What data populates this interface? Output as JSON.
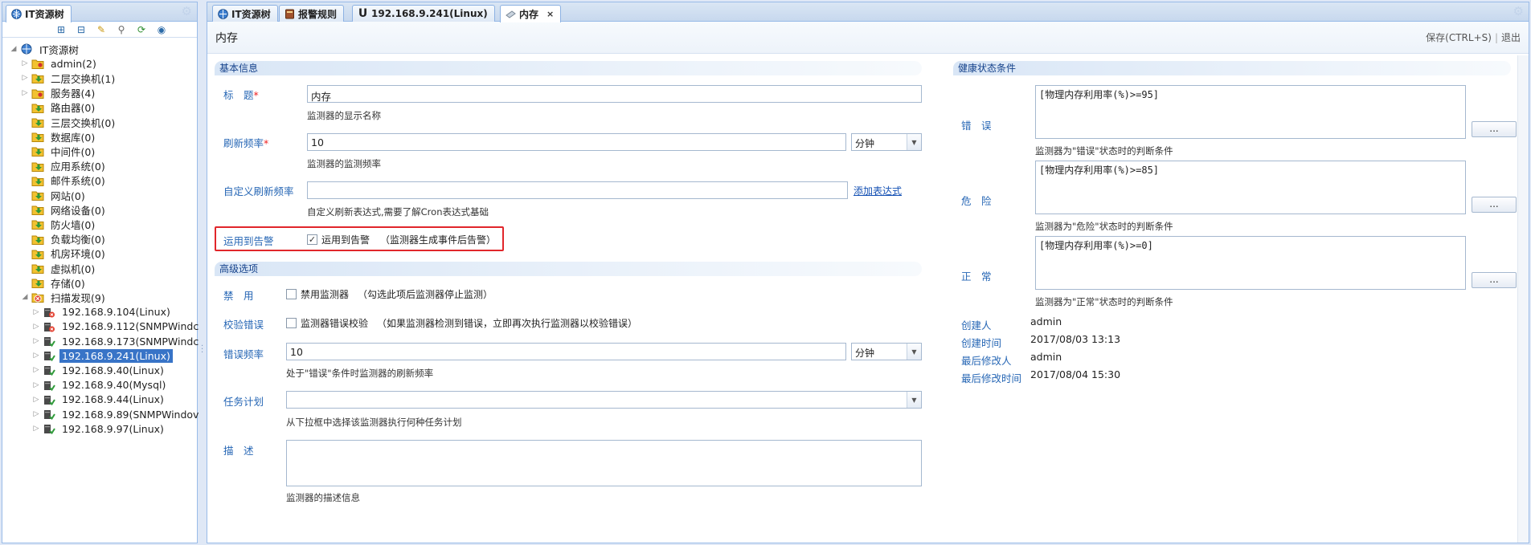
{
  "left_panel": {
    "tab_label": "IT资源树",
    "tree": [
      {
        "label": "IT资源树",
        "indent": 0,
        "toggle": "◢",
        "icon": "globe",
        "selected": false
      },
      {
        "label": "admin(2)",
        "indent": 1,
        "toggle": "▷",
        "icon": "folder-user",
        "selected": false
      },
      {
        "label": "二层交换机(1)",
        "indent": 1,
        "toggle": "▷",
        "icon": "folder-arrow",
        "selected": false
      },
      {
        "label": "服务器(4)",
        "indent": 1,
        "toggle": "▷",
        "icon": "folder-user",
        "selected": false
      },
      {
        "label": "路由器(0)",
        "indent": 1,
        "toggle": "",
        "icon": "folder-arrow",
        "selected": false
      },
      {
        "label": "三层交换机(0)",
        "indent": 1,
        "toggle": "",
        "icon": "folder-arrow",
        "selected": false
      },
      {
        "label": "数据库(0)",
        "indent": 1,
        "toggle": "",
        "icon": "folder-arrow",
        "selected": false
      },
      {
        "label": "中间件(0)",
        "indent": 1,
        "toggle": "",
        "icon": "folder-arrow",
        "selected": false
      },
      {
        "label": "应用系统(0)",
        "indent": 1,
        "toggle": "",
        "icon": "folder-arrow",
        "selected": false
      },
      {
        "label": "邮件系统(0)",
        "indent": 1,
        "toggle": "",
        "icon": "folder-arrow",
        "selected": false
      },
      {
        "label": "网站(0)",
        "indent": 1,
        "toggle": "",
        "icon": "folder-arrow",
        "selected": false
      },
      {
        "label": "网络设备(0)",
        "indent": 1,
        "toggle": "",
        "icon": "folder-arrow",
        "selected": false
      },
      {
        "label": "防火墙(0)",
        "indent": 1,
        "toggle": "",
        "icon": "folder-arrow",
        "selected": false
      },
      {
        "label": "负载均衡(0)",
        "indent": 1,
        "toggle": "",
        "icon": "folder-arrow",
        "selected": false
      },
      {
        "label": "机房环境(0)",
        "indent": 1,
        "toggle": "",
        "icon": "folder-arrow",
        "selected": false
      },
      {
        "label": "虚拟机(0)",
        "indent": 1,
        "toggle": "",
        "icon": "folder-arrow",
        "selected": false
      },
      {
        "label": "存储(0)",
        "indent": 1,
        "toggle": "",
        "icon": "folder-arrow",
        "selected": false
      },
      {
        "label": "扫描发现(9)",
        "indent": 1,
        "toggle": "◢",
        "icon": "scan-red",
        "selected": false
      },
      {
        "label": "192.168.9.104(Linux)",
        "indent": 2,
        "toggle": "▷",
        "icon": "server-error",
        "selected": false
      },
      {
        "label": "192.168.9.112(SNMPWindc",
        "indent": 2,
        "toggle": "▷",
        "icon": "server-error",
        "selected": false
      },
      {
        "label": "192.168.9.173(SNMPWindc",
        "indent": 2,
        "toggle": "▷",
        "icon": "server-ok",
        "selected": false
      },
      {
        "label": "192.168.9.241(Linux)",
        "indent": 2,
        "toggle": "▷",
        "icon": "server-ok",
        "selected": true
      },
      {
        "label": "192.168.9.40(Linux)",
        "indent": 2,
        "toggle": "▷",
        "icon": "server-ok",
        "selected": false
      },
      {
        "label": "192.168.9.40(Mysql)",
        "indent": 2,
        "toggle": "▷",
        "icon": "server-ok",
        "selected": false
      },
      {
        "label": "192.168.9.44(Linux)",
        "indent": 2,
        "toggle": "▷",
        "icon": "server-ok",
        "selected": false
      },
      {
        "label": "192.168.9.89(SNMPWindov",
        "indent": 2,
        "toggle": "▷",
        "icon": "server-ok",
        "selected": false
      },
      {
        "label": "192.168.9.97(Linux)",
        "indent": 2,
        "toggle": "▷",
        "icon": "server-ok",
        "selected": false
      }
    ]
  },
  "main_tabs": [
    {
      "label": "IT资源树",
      "icon": "globe-icon",
      "active": false
    },
    {
      "label": "报警规则",
      "icon": "book-icon",
      "active": false
    },
    {
      "label": "192.168.9.241(Linux)",
      "icon": "u-icon",
      "active": false
    },
    {
      "label": "内存",
      "icon": "memory-icon",
      "active": true,
      "close": "×"
    }
  ],
  "page": {
    "title": "内存",
    "save_label": "保存(CTRL+S)",
    "sep": "|",
    "exit_label": "退出"
  },
  "basic": {
    "section_title": "基本信息",
    "title_label": "标　题",
    "required_mark": "*",
    "title_value": "内存",
    "title_hint": "监测器的显示名称",
    "refresh_label": "刷新频率",
    "refresh_value": "10",
    "refresh_unit": "分钟",
    "refresh_hint": "监测器的监测频率",
    "custom_label": "自定义刷新频率",
    "custom_value": "",
    "custom_link": "添加表达式",
    "custom_hint": "自定义刷新表达式,需要了解Cron表达式基础",
    "alarm_label": "运用到告警",
    "alarm_checked": true,
    "alarm_check_text": "运用到告警",
    "alarm_note": "（监测器生成事件后告警）"
  },
  "advanced": {
    "section_title": "高级选项",
    "disable_label": "禁　用",
    "disable_check_text": "禁用监测器",
    "disable_note": "（勾选此项后监测器停止监测）",
    "verify_label": "校验错误",
    "verify_check_text": "监测器错误校验",
    "verify_note": "（如果监测器检测到错误，立即再次执行监测器以校验错误）",
    "errfreq_label": "错误频率",
    "errfreq_value": "10",
    "errfreq_unit": "分钟",
    "errfreq_hint": "处于\"错误\"条件时监测器的刷新频率",
    "schedule_label": "任务计划",
    "schedule_value": "",
    "schedule_hint": "从下拉框中选择该监测器执行何种任务计划",
    "desc_label": "描　述",
    "desc_value": "",
    "desc_hint": "监测器的描述信息"
  },
  "health": {
    "section_title": "健康状态条件",
    "error_label": "错　误",
    "error_value": "[物理内存利用率(%)>=95]",
    "error_hint": "监测器为\"错误\"状态时的判断条件",
    "danger_label": "危　险",
    "danger_value": "[物理内存利用率(%)>=85]",
    "danger_hint": "监测器为\"危险\"状态时的判断条件",
    "normal_label": "正　常",
    "normal_value": "[物理内存利用率(%)>=0]",
    "normal_hint": "监测器为\"正常\"状态时的判断条件",
    "dots_label": "..."
  },
  "meta": {
    "creator_label": "创建人",
    "creator_value": "admin",
    "created_label": "创建时间",
    "created_value": "2017/08/03 13:13",
    "modifier_label": "最后修改人",
    "modifier_value": "admin",
    "modified_label": "最后修改时间",
    "modified_value": "2017/08/04 15:30"
  },
  "colors": {
    "accent": "#3874c7",
    "label_blue": "#2767b5",
    "highlight_frame": "#e1262b"
  }
}
